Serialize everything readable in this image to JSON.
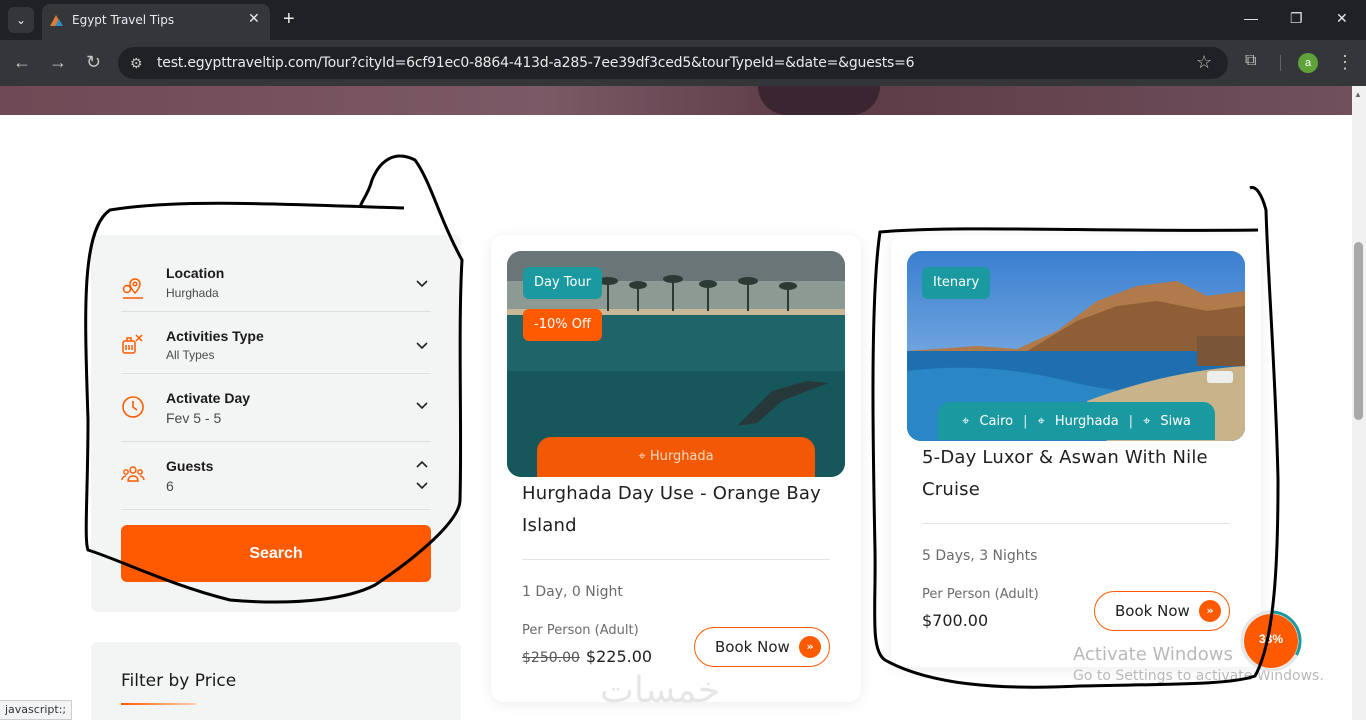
{
  "browser": {
    "tab_title": "Egypt Travel Tips",
    "url": "test.egypttraveltip.com/Tour?cityId=6cf91ec0-8864-413d-a285-7ee39df3ced5&tourTypeId=&date=&guests=6",
    "profile_initial": "a",
    "status_text": "javascript:;"
  },
  "search_panel": {
    "location": {
      "label": "Location",
      "value": "Hurghada"
    },
    "activities": {
      "label": "Activities Type",
      "value": "All Types"
    },
    "day": {
      "label": "Activate Day",
      "value": "Fev 5 - 5"
    },
    "guests": {
      "label": "Guests",
      "value": "6"
    },
    "search_label": "Search"
  },
  "filter": {
    "title": "Filter by Price"
  },
  "cards": [
    {
      "badge_type": "Day Tour",
      "badge_discount": "-10% Off",
      "location": "Hurghada",
      "title_line1": "Hurghada Day Use - Orange Bay",
      "title_line2": "Island",
      "duration": "1 Day, 0 Night",
      "per_person": "Per Person (Adult)",
      "old_price": "$250.00",
      "price": "$225.00",
      "book_label": "Book Now"
    },
    {
      "badge_type": "Itenary",
      "locations": [
        "Cairo",
        "Hurghada",
        "Siwa"
      ],
      "title_line1": "5-Day Luxor & Aswan With Nile",
      "title_line2": "Cruise",
      "duration": "5 Days, 3 Nights",
      "per_person": "Per Person (Adult)",
      "price": "$700.00",
      "book_label": "Book Now"
    }
  ],
  "overlay": {
    "activate_title": "Activate Windows",
    "activate_sub": "Go to Settings to activate Windows.",
    "progress_label": "33%",
    "progress": 0.33,
    "watermark": "خمسات"
  },
  "colors": {
    "accent": "#ff5a00",
    "teal": "#1a9aa0"
  }
}
